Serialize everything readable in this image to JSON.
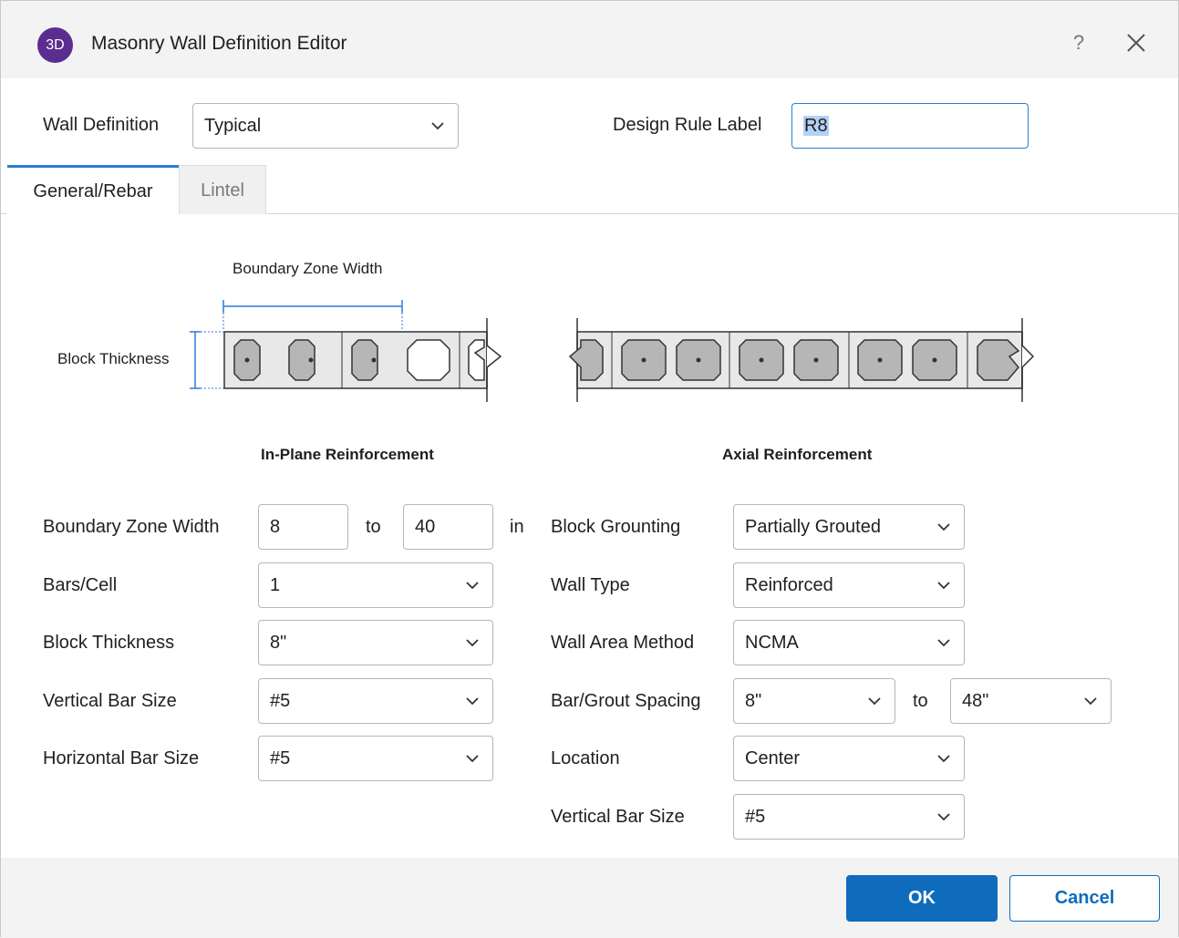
{
  "window": {
    "icon_text": "3D",
    "title": "Masonry Wall Definition Editor",
    "help_glyph": "?",
    "accent": "#0f6cbd",
    "icon_color": "#5c2d91"
  },
  "header": {
    "wall_definition_label": "Wall Definition",
    "wall_definition_value": "Typical",
    "design_rule_label": "Design Rule Label",
    "design_rule_value": "R8"
  },
  "tabs": [
    {
      "label": "General/Rebar",
      "active": true
    },
    {
      "label": "Lintel",
      "active": false
    }
  ],
  "diagram": {
    "boundary_zone_width": "Boundary Zone Width",
    "block_thickness": "Block Thickness"
  },
  "in_plane": {
    "title": "In-Plane Reinforcement",
    "boundary_zone_width_label": "Boundary Zone Width",
    "boundary_zone_from": "8",
    "to_label": "to",
    "boundary_zone_to": "40",
    "unit": "in",
    "bars_per_cell_label": "Bars/Cell",
    "bars_per_cell_value": "1",
    "block_thickness_label": "Block Thickness",
    "block_thickness_value": "8\"",
    "vertical_bar_size_label": "Vertical Bar Size",
    "vertical_bar_size_value": "#5",
    "horizontal_bar_size_label": "Horizontal Bar Size",
    "horizontal_bar_size_value": "#5"
  },
  "axial": {
    "title": "Axial Reinforcement",
    "block_grouting_label": "Block Grounting",
    "block_grouting_value": "Partially Grouted",
    "wall_type_label": "Wall Type",
    "wall_type_value": "Reinforced",
    "wall_area_method_label": "Wall Area Method",
    "wall_area_method_value": "NCMA",
    "bar_grout_spacing_label": "Bar/Grout Spacing",
    "bar_grout_spacing_from": "8\"",
    "to_label": "to",
    "bar_grout_spacing_to": "48\"",
    "location_label": "Location",
    "location_value": "Center",
    "vertical_bar_size_label": "Vertical Bar Size",
    "vertical_bar_size_value": "#5"
  },
  "footer": {
    "ok_label": "OK",
    "cancel_label": "Cancel"
  }
}
